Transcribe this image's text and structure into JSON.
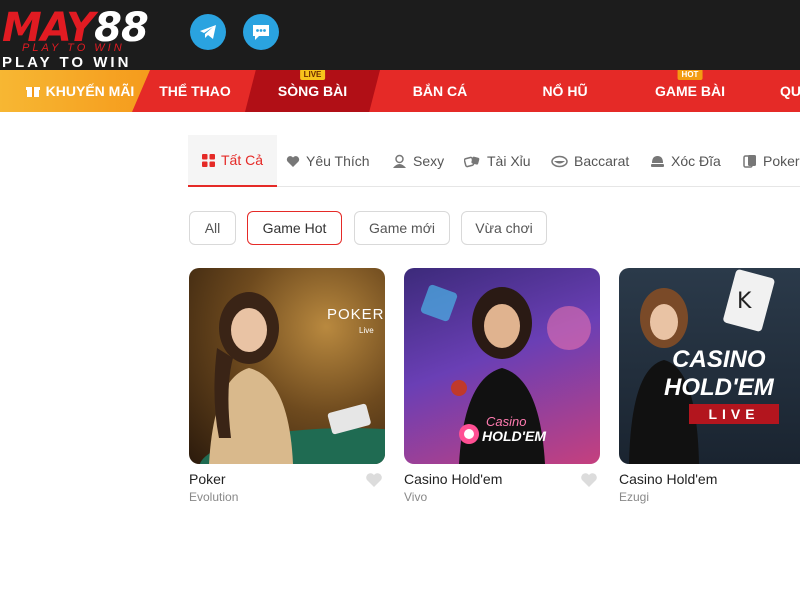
{
  "brand": {
    "name_letters": "MAY",
    "name_number": "88",
    "tagline_small": "PLAY TO WIN",
    "tagline": "PLAY TO WIN"
  },
  "nav": {
    "items": [
      {
        "label": "KHUYẾN MÃI"
      },
      {
        "label": "THỂ THAO"
      },
      {
        "label": "SÒNG BÀI",
        "tag": "LIVE"
      },
      {
        "label": "BẮN CÁ"
      },
      {
        "label": "NỔ HŨ"
      },
      {
        "label": "GAME BÀI",
        "tag": "HOT"
      },
      {
        "label": "QU"
      }
    ]
  },
  "tabs": [
    {
      "label": "Tất Cả",
      "icon": "grid-icon"
    },
    {
      "label": "Yêu Thích",
      "icon": "heart-icon"
    },
    {
      "label": "Sexy",
      "icon": "dealer-icon"
    },
    {
      "label": "Tài Xỉu",
      "icon": "dice-icon"
    },
    {
      "label": "Baccarat",
      "icon": "cards-icon"
    },
    {
      "label": "Xóc Đĩa",
      "icon": "bowl-icon"
    },
    {
      "label": "Poker",
      "icon": "poker-icon"
    }
  ],
  "filters": [
    {
      "label": "All"
    },
    {
      "label": "Game Hot"
    },
    {
      "label": "Game mới"
    },
    {
      "label": "Vừa chơi"
    }
  ],
  "games": [
    {
      "name": "Poker",
      "provider": "Evolution",
      "thumb_title": "POKER",
      "thumb_sub": "Live"
    },
    {
      "name": "Casino Hold'em",
      "provider": "Vivo",
      "thumb_title": "Casino",
      "thumb_sub": "HOLD'EM"
    },
    {
      "name": "Casino Hold'em",
      "provider": "Ezugi",
      "thumb_title": "CASINO\nHOLD'EM",
      "thumb_sub": "LIVE"
    }
  ],
  "colors": {
    "accent": "#e52a27",
    "topbar": "#1c1c1c",
    "promo": "#f7b733",
    "active_nav": "#b10f16"
  }
}
